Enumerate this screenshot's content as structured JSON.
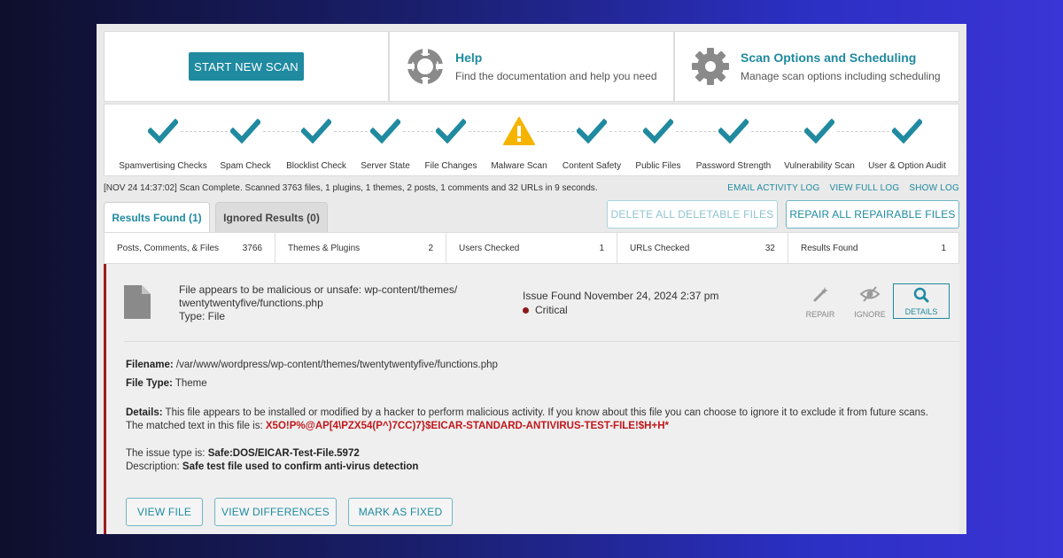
{
  "cards": {
    "start_label": "START NEW SCAN",
    "help_title": "Help",
    "help_sub": "Find the documentation and help you need",
    "opts_title": "Scan Options and Scheduling",
    "opts_sub": "Manage scan options including scheduling"
  },
  "steps": [
    {
      "label": "Spamvertising Checks",
      "status": "ok"
    },
    {
      "label": "Spam Check",
      "status": "ok"
    },
    {
      "label": "Blocklist Check",
      "status": "ok"
    },
    {
      "label": "Server State",
      "status": "ok"
    },
    {
      "label": "File Changes",
      "status": "ok"
    },
    {
      "label": "Malware Scan",
      "status": "warning"
    },
    {
      "label": "Content Safety",
      "status": "ok"
    },
    {
      "label": "Public Files",
      "status": "ok"
    },
    {
      "label": "Password Strength",
      "status": "ok"
    },
    {
      "label": "Vulnerability Scan",
      "status": "ok"
    },
    {
      "label": "User & Option Audit",
      "status": "ok"
    }
  ],
  "summary": "[NOV 24 14:37:02] Scan Complete. Scanned 3763 files, 1 plugins, 1 themes, 2 posts, 1 comments and 32 URLs in 9 seconds.",
  "links": {
    "email": "EMAIL ACTIVITY LOG",
    "full": "VIEW FULL LOG",
    "show": "SHOW LOG"
  },
  "tabs": {
    "results": "Results Found (1)",
    "ignored": "Ignored Results (0)"
  },
  "actions": {
    "delete": "DELETE ALL DELETABLE FILES",
    "repair": "REPAIR ALL REPAIRABLE FILES"
  },
  "stats": [
    {
      "label": "Posts, Comments, & Files",
      "value": "3766"
    },
    {
      "label": "Themes & Plugins",
      "value": "2"
    },
    {
      "label": "Users Checked",
      "value": "1"
    },
    {
      "label": "URLs Checked",
      "value": "32"
    },
    {
      "label": "Results Found",
      "value": "1"
    }
  ],
  "result": {
    "title_line1": "File appears to be malicious or unsafe: wp-content/themes/",
    "title_line2": "twentytwentyfive/functions.php",
    "type_line": "Type: File",
    "issue_date": "Issue Found November 24, 2024 2:37 pm",
    "severity": "Critical",
    "repair": "REPAIR",
    "ignore": "IGNORE",
    "details": "DETAILS",
    "filename_label": "Filename:",
    "filename": "/var/www/wordpress/wp-content/themes/twentytwentyfive/functions.php",
    "filetype_label": "File Type:",
    "filetype": "Theme",
    "details_label": "Details:",
    "details_text": "This file appears to be installed or modified by a hacker to perform malicious activity. If you know about this file you can choose to ignore it to exclude it from future scans.",
    "matched_prefix": "The matched text in this file is:",
    "matched": "X5O!P%@AP[4\\PZX54(P^)7CC)7}$EICAR-STANDARD-ANTIVIRUS-TEST-FILE!$H+H*",
    "issue_type_prefix": "The issue type is:",
    "issue_type": "Safe:DOS/EICAR-Test-File.5972",
    "desc_prefix": "Description:",
    "desc": "Safe test file used to confirm anti-virus detection",
    "view_file": "VIEW FILE",
    "view_diff": "VIEW DIFFERENCES",
    "mark_fixed": "MARK AS FIXED"
  },
  "colors": {
    "accent": "#1f8aa0",
    "critical": "#9b1b1b",
    "warning": "#f5b400"
  }
}
